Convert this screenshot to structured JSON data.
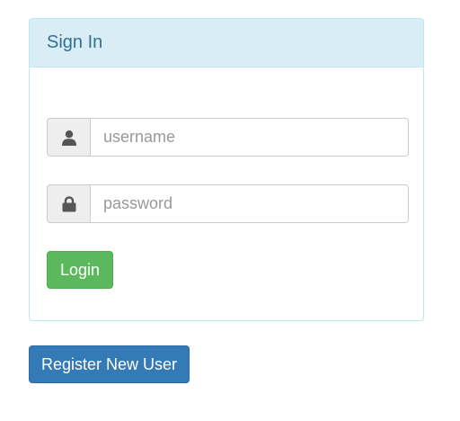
{
  "panel": {
    "title": "Sign In"
  },
  "login_form": {
    "username": {
      "placeholder": "username",
      "value": "",
      "icon": "user-icon"
    },
    "password": {
      "placeholder": "password",
      "value": "",
      "icon": "lock-icon"
    },
    "login_label": "Login"
  },
  "actions": {
    "register_label": "Register New User"
  },
  "colors": {
    "panel_heading_bg": "#d9edf7",
    "panel_heading_text": "#31708f",
    "panel_border": "#bce8f1",
    "login_button": "#5cb85c",
    "register_button": "#337ab7",
    "addon_bg": "#eeeeee",
    "icon": "#555555"
  }
}
